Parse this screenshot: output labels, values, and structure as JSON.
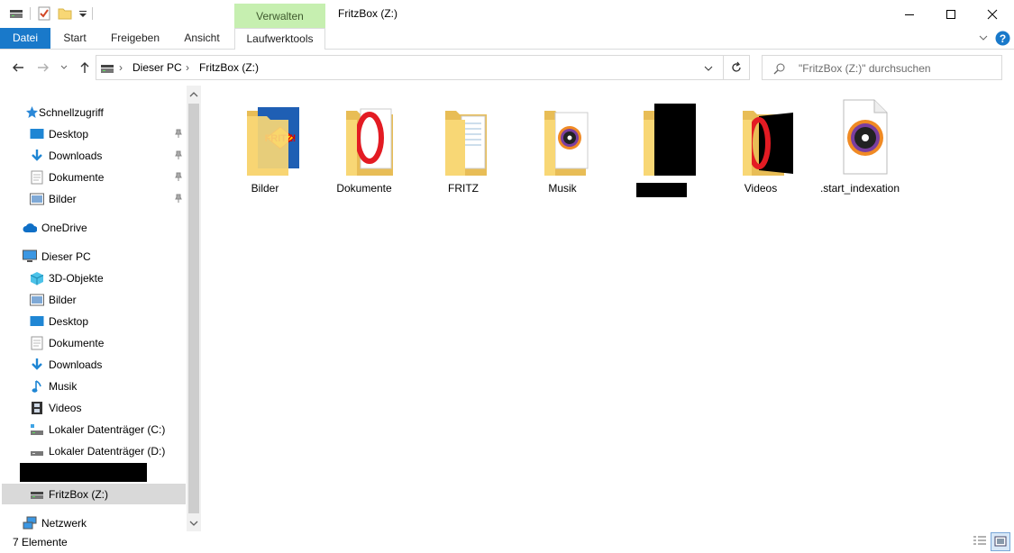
{
  "window": {
    "title": "FritzBox (Z:)",
    "context_tab_header": "Verwalten"
  },
  "ribbon": {
    "tabs": [
      "Datei",
      "Start",
      "Freigeben",
      "Ansicht",
      "Laufwerktools"
    ]
  },
  "address": {
    "breadcrumb": [
      "Dieser PC",
      "FritzBox (Z:)"
    ]
  },
  "search": {
    "placeholder": "\"FritzBox (Z:)\" durchsuchen"
  },
  "nav": {
    "quick_access": "Schnellzugriff",
    "quick_items": [
      "Desktop",
      "Downloads",
      "Dokumente",
      "Bilder"
    ],
    "onedrive": "OneDrive",
    "this_pc": "Dieser PC",
    "pc_items": [
      "3D-Objekte",
      "Bilder",
      "Desktop",
      "Dokumente",
      "Downloads",
      "Musik",
      "Videos",
      "Lokaler Datenträger (C:)",
      "Lokaler Datenträger (D:)"
    ],
    "current_drive": "FritzBox (Z:)",
    "network": "Netzwerk"
  },
  "items": [
    {
      "name": "Bilder",
      "icon": "folder-fritz-icon"
    },
    {
      "name": "Dokumente",
      "icon": "folder-opera-icon"
    },
    {
      "name": "FRITZ",
      "icon": "folder-icon"
    },
    {
      "name": "Musik",
      "icon": "folder-music-icon"
    },
    {
      "name": "",
      "icon": "folder-redacted-icon"
    },
    {
      "name": "Videos",
      "icon": "folder-opera-icon"
    },
    {
      "name": ".start_indexation",
      "icon": "music-file-icon"
    }
  ],
  "status": {
    "count": "7 Elemente"
  },
  "colors": {
    "accent": "#1979ca",
    "context_tab": "#c6efb0",
    "folder": "#f8d775"
  }
}
